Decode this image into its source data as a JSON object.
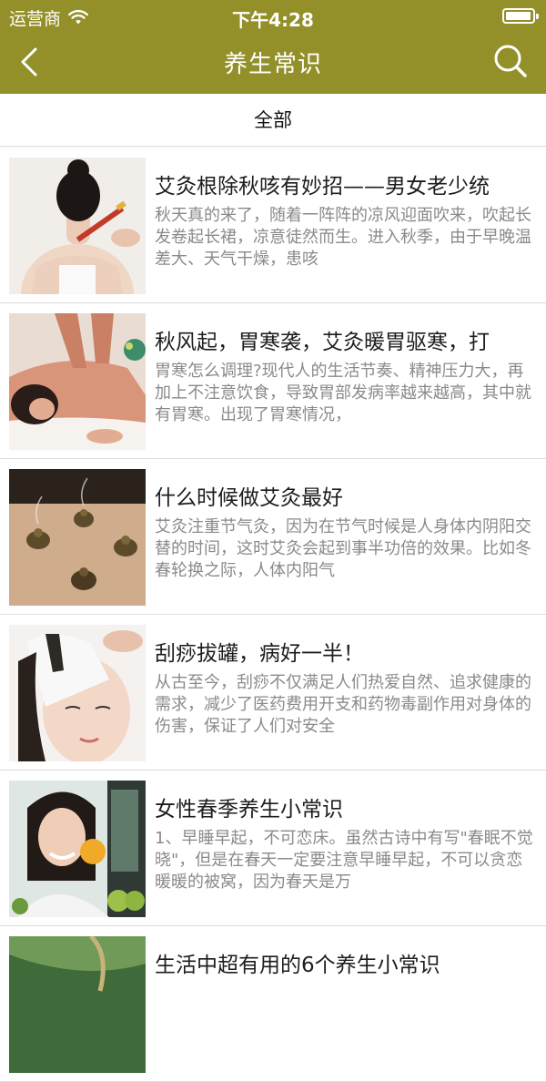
{
  "status_bar": {
    "carrier": "运营商",
    "time": "下午4:28",
    "battery_level": 0.95
  },
  "nav": {
    "title": "养生常识",
    "back_icon": "chevron-left-icon",
    "search_icon": "search-icon"
  },
  "category": {
    "label": "全部"
  },
  "colors": {
    "header": "#93902a",
    "title_text": "#1d1d1d",
    "summary_text": "#8a8a8a"
  },
  "articles": [
    {
      "title": "艾灸根除秋咳有妙招——男女老少统",
      "summary": "秋天真的来了，随着一阵阵的凉风迎面吹来，吹起长发卷起长裙，凉意徒然而生。进入秋季，由于早晚温差大、天气干燥，患咳",
      "image": "moxibustion-back-photo"
    },
    {
      "title": "秋风起，胃寒袭，艾灸暖胃驱寒，打",
      "summary": "胃寒怎么调理?现代人的生活节奏、精神压力大，再加上不注意饮食，导致胃部发病率越来越高，其中就有胃寒。出现了胃寒情况，",
      "image": "massage-spa-photo"
    },
    {
      "title": "什么时候做艾灸最好",
      "summary": "艾灸注重节气灸，因为在节气时候是人身体内阴阳交替的时间，这时艾灸会起到事半功倍的效果。比如冬春轮换之际，人体内阳气",
      "image": "moxa-cones-photo"
    },
    {
      "title": "刮痧拔罐，病好一半！",
      "summary": "从古至今，刮痧不仅满足人们热爱自然、追求健康的需求，减少了医药费用开支和药物毒副作用对身体的伤害，保证了人们对安全",
      "image": "facial-scraping-photo"
    },
    {
      "title": "女性春季养生小常识",
      "summary": "1、早睡早起，不可恋床。虽然古诗中有写\"春眠不觉晓\"，但是在春天一定要注意早睡早起，不可以贪恋暖暖的被窝，因为春天是万",
      "image": "woman-orange-photo"
    },
    {
      "title": "生活中超有用的6个养生小常识",
      "summary": "",
      "image": "greenery-photo"
    }
  ]
}
